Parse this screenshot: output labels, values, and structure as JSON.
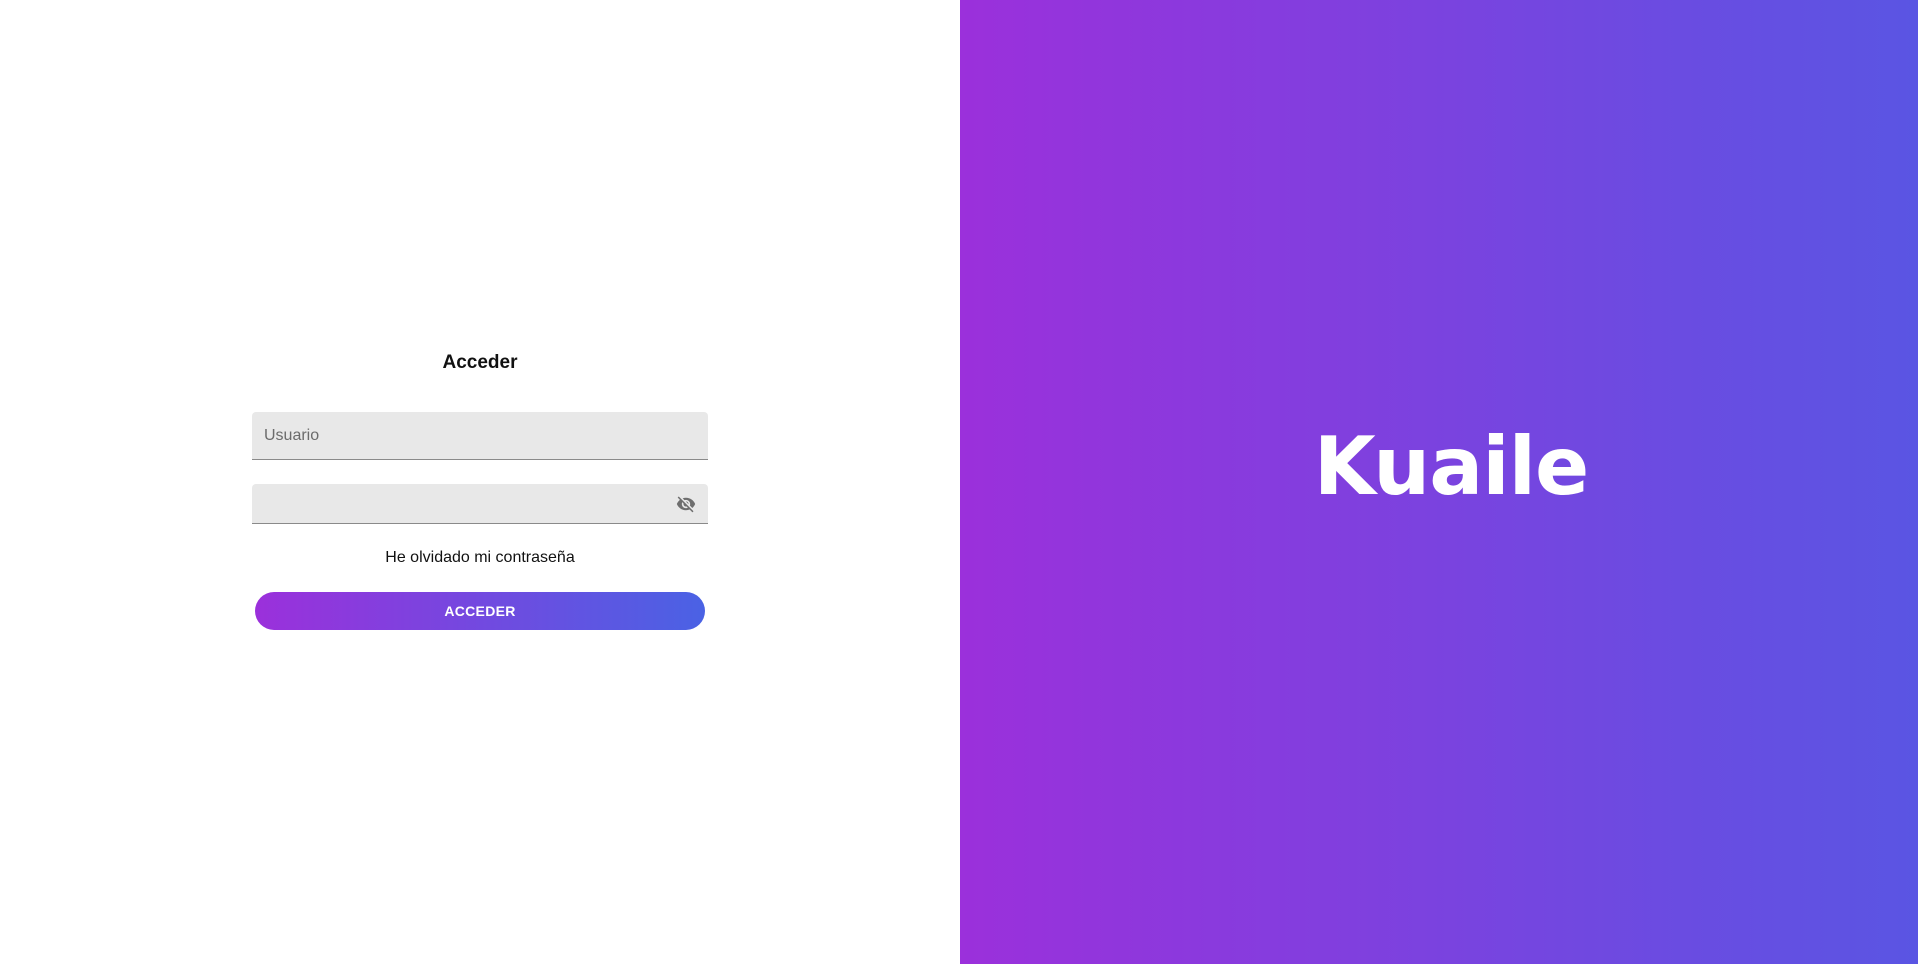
{
  "login": {
    "title": "Acceder",
    "username_placeholder": "Usuario",
    "username_value": "",
    "password_value": "",
    "password_toggle_icon": "eye-off-icon",
    "forgot_password": "He olvidado mi contraseña",
    "submit_label": "ACCEDER"
  },
  "brand": {
    "name": "Kuaile"
  },
  "colors": {
    "gradient_start": "#9b30db",
    "gradient_end": "#5a55e3",
    "button_gradient_start": "#9b30db",
    "button_gradient_end": "#4a62e4",
    "field_background": "#e8e8e8",
    "text": "#111111"
  }
}
